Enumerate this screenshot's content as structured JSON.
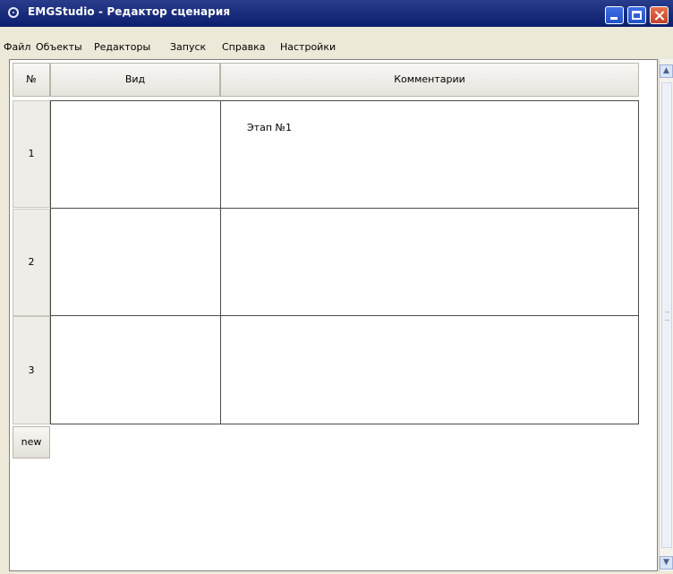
{
  "window": {
    "title": "EMGStudio - Редактор сценария"
  },
  "menu": [
    "Файл",
    "Объекты",
    "Редакторы",
    "Запуск",
    "Справка",
    "Настройки"
  ],
  "table": {
    "headers": {
      "number": "№",
      "view": "Вид",
      "comment": "Комментарии"
    },
    "rows": [
      {
        "number": "1",
        "comment": "Этап №1"
      },
      {
        "number": "2",
        "comment": ""
      },
      {
        "number": "3",
        "comment": ""
      }
    ],
    "new_label": "new"
  },
  "scrollbar": {
    "up_glyph": "▲",
    "down_glyph": "▼"
  },
  "colors": {
    "titlebar": "#0b1f6e",
    "close_button": "#c4412a",
    "window_face": "#ece9d8"
  }
}
